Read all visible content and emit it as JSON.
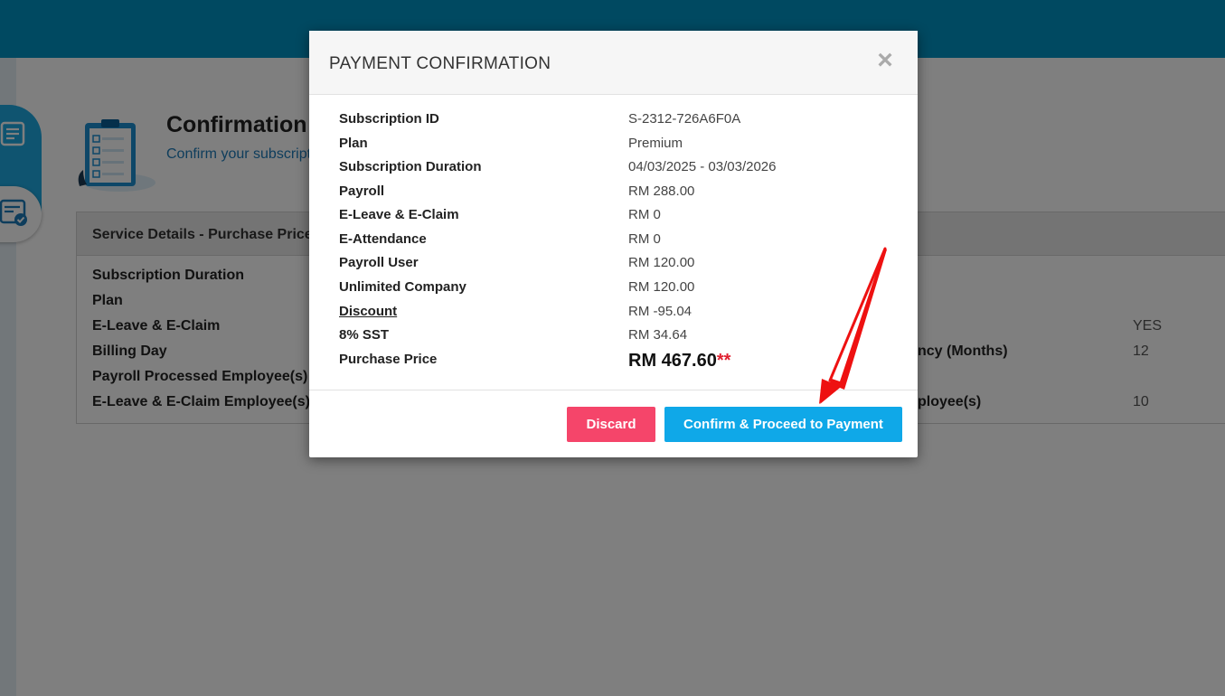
{
  "page": {
    "title": "Confirmation",
    "subtitle": "Confirm your subscripti",
    "details_header": "Service Details - Purchase Price",
    "details_left": [
      "Subscription Duration",
      "Plan",
      "E-Leave & E-Claim",
      "Billing Day",
      "Payroll Processed Employee(s)",
      "E-Leave & E-Claim Employee(s)"
    ],
    "details_right": [
      {
        "label": "",
        "value": "YES"
      },
      {
        "label": "ncy (Months)",
        "value": "12"
      },
      {
        "label": "ployee(s)",
        "value": "10"
      }
    ]
  },
  "modal": {
    "title": "PAYMENT CONFIRMATION",
    "close_symbol": "×",
    "rows": [
      {
        "label": "Subscription ID",
        "value": "S-2312-726A6F0A"
      },
      {
        "label": "Plan",
        "value": "Premium"
      },
      {
        "label": "Subscription Duration",
        "value": "04/03/2025 - 03/03/2026"
      },
      {
        "label": "Payroll",
        "value": "RM 288.00"
      },
      {
        "label": "E-Leave & E-Claim",
        "value": "RM 0"
      },
      {
        "label": "E-Attendance",
        "value": "RM 0"
      },
      {
        "label": "Payroll User",
        "value": "RM 120.00"
      },
      {
        "label": "Unlimited Company",
        "value": "RM 120.00"
      },
      {
        "label": "Discount",
        "value": "RM -95.04"
      },
      {
        "label": "8% SST",
        "value": "RM 34.64"
      }
    ],
    "purchase_price_label": "Purchase Price",
    "purchase_price_value": "RM 467.60",
    "purchase_price_mark": "**",
    "discard_label": "Discard",
    "confirm_label": "Confirm & Proceed to Payment"
  },
  "colors": {
    "topbar": "#0092c2",
    "discard": "#f5456a",
    "confirm": "#0fa8e8",
    "arrow": "#ee1111"
  }
}
